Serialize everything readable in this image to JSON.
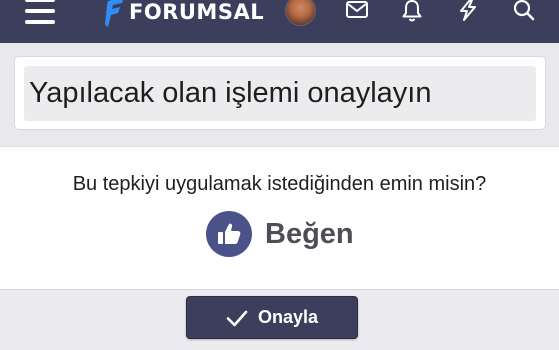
{
  "header": {
    "logo_text": "FORUMSAL",
    "icons": [
      "menu-icon",
      "logo-f-icon",
      "avatar",
      "envelope-icon",
      "bell-icon",
      "lightning-icon",
      "search-icon"
    ]
  },
  "page": {
    "title": "Yapılacak olan işlemi onaylayın"
  },
  "confirm": {
    "question": "Bu tepkiyi uygulamak istediğinden emin misin?",
    "reaction_label": "Beğen",
    "reaction_icon": "thumbs-up-icon",
    "button_label": "Onayla",
    "button_icon": "checkmark-icon"
  },
  "colors": {
    "topbar": "#3b3f5c",
    "logo_accent": "#2f8df5",
    "like_circle": "#4a5289",
    "button": "#3b3f5c"
  }
}
